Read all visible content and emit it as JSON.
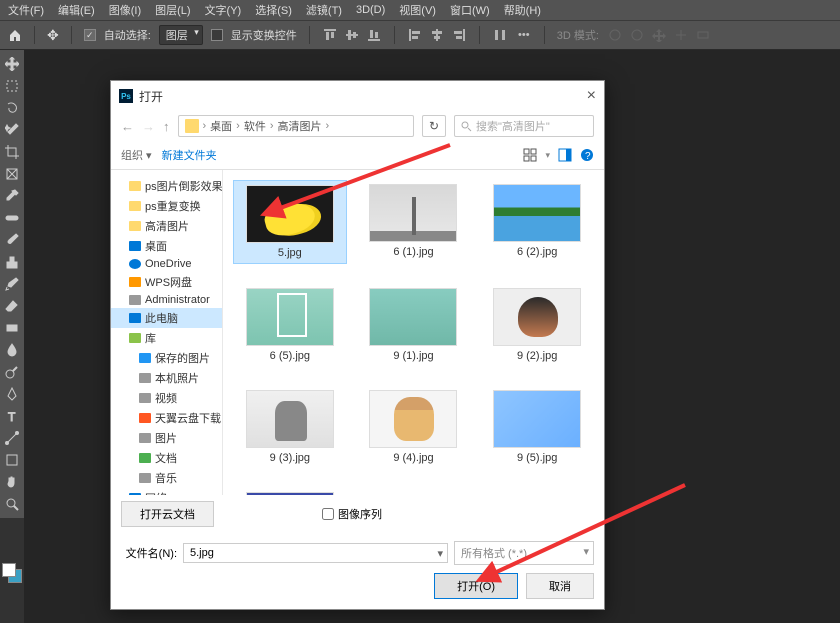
{
  "menubar": [
    "文件(F)",
    "编辑(E)",
    "图像(I)",
    "图层(L)",
    "文字(Y)",
    "选择(S)",
    "滤镜(T)",
    "3D(D)",
    "视图(V)",
    "窗口(W)",
    "帮助(H)"
  ],
  "toolbar": {
    "auto_select": "自动选择:",
    "layer_select": "图层",
    "show_transform": "显示变换控件",
    "threed_mode": "3D 模式:"
  },
  "dialog": {
    "title": "打开",
    "breadcrumb": [
      "桌面",
      "软件",
      "高清图片"
    ],
    "search_placeholder": "搜索\"高清图片\"",
    "organize": "组织",
    "new_folder": "新建文件夹",
    "tree": [
      {
        "label": "ps图片倒影效果",
        "icon": "folder",
        "lvl": 2
      },
      {
        "label": "ps重复变换",
        "icon": "folder",
        "lvl": 2
      },
      {
        "label": "高清图片",
        "icon": "folder",
        "lvl": 2
      },
      {
        "label": "桌面",
        "icon": "desk",
        "lvl": 1
      },
      {
        "label": "OneDrive",
        "icon": "cloud",
        "lvl": 2
      },
      {
        "label": "WPS网盘",
        "icon": "wps",
        "lvl": 2
      },
      {
        "label": "Administrator",
        "icon": "user",
        "lvl": 2
      },
      {
        "label": "此电脑",
        "icon": "pc",
        "lvl": 2,
        "selected": true
      },
      {
        "label": "库",
        "icon": "lib",
        "lvl": 2
      },
      {
        "label": "保存的图片",
        "icon": "blue2",
        "lvl": 3
      },
      {
        "label": "本机照片",
        "icon": "gray",
        "lvl": 3
      },
      {
        "label": "视频",
        "icon": "gray",
        "lvl": 3
      },
      {
        "label": "天翼云盘下载",
        "icon": "orange",
        "lvl": 3
      },
      {
        "label": "图片",
        "icon": "gray",
        "lvl": 3
      },
      {
        "label": "文档",
        "icon": "green",
        "lvl": 3
      },
      {
        "label": "音乐",
        "icon": "gray",
        "lvl": 3
      },
      {
        "label": "网络",
        "icon": "net",
        "lvl": 2
      }
    ],
    "files": [
      {
        "name": "5.jpg",
        "thumb": "banana",
        "selected": true
      },
      {
        "name": "6 (1).jpg",
        "thumb": "city"
      },
      {
        "name": "6 (2).jpg",
        "thumb": "lake"
      },
      {
        "name": "6 (5).jpg",
        "thumb": "mint"
      },
      {
        "name": "9 (1).jpg",
        "thumb": "mint2"
      },
      {
        "name": "9 (2).jpg",
        "thumb": "girl1"
      },
      {
        "name": "9 (3).jpg",
        "thumb": "gray"
      },
      {
        "name": "9 (4).jpg",
        "thumb": "girl2"
      },
      {
        "name": "9 (5).jpg",
        "thumb": "blue"
      },
      {
        "name": "",
        "thumb": "pattern"
      }
    ],
    "open_cloud": "打开云文档",
    "image_sequence": "图像序列",
    "filename_label": "文件名(N):",
    "filename_value": "5.jpg",
    "filetype": "所有格式 (*.*)",
    "btn_open": "打开(O)",
    "btn_cancel": "取消"
  }
}
